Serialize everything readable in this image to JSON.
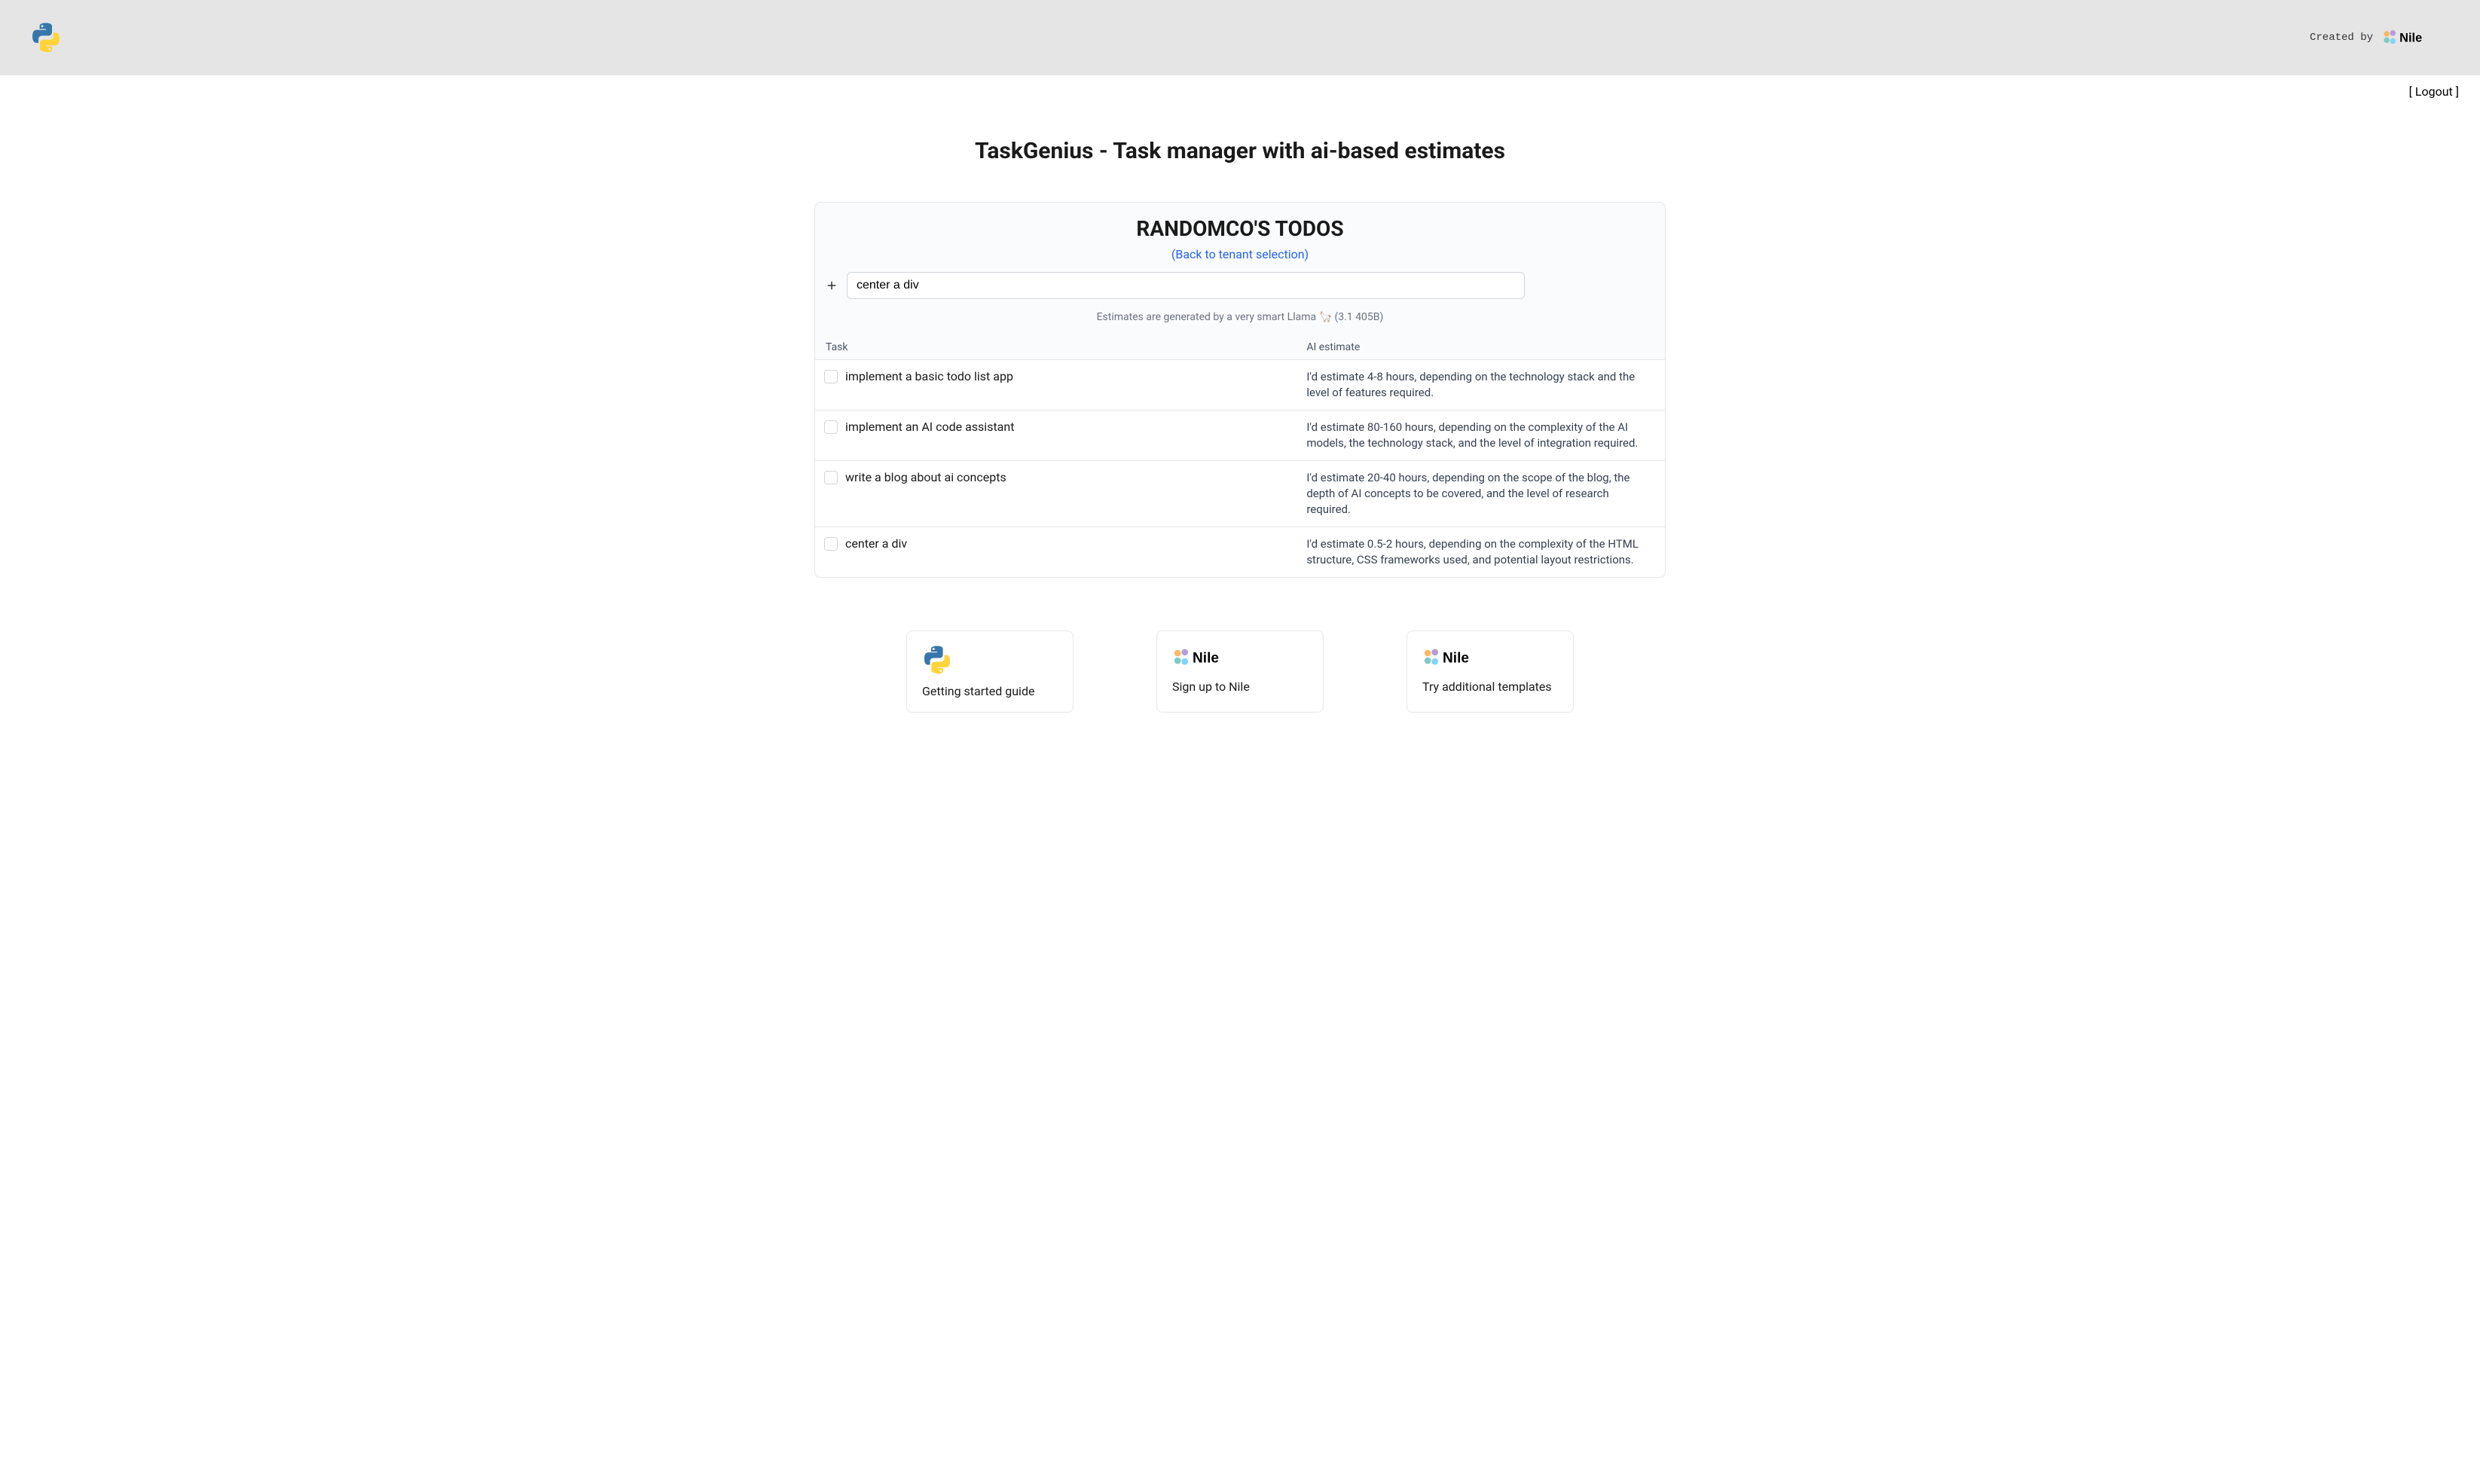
{
  "header": {
    "created_by": "Created by"
  },
  "logout": {
    "label": "[ Logout ]"
  },
  "main_title": "TaskGenius - Task manager with ai-based estimates",
  "todos": {
    "title": "RANDOMCO'S TODOS",
    "back_link": "(Back to tenant selection)",
    "input_value": "center a div",
    "estimate_note": "Estimates are generated by a very smart Llama 🦙 (3.1 405B)",
    "columns": {
      "task": "Task",
      "estimate": "AI estimate"
    },
    "items": [
      {
        "name": "implement a basic todo list app",
        "estimate": "I'd estimate 4-8 hours, depending on the technology stack and the level of features required."
      },
      {
        "name": "implement an AI code assistant",
        "estimate": "I'd estimate 80-160 hours, depending on the complexity of the AI models, the technology stack, and the level of integration required."
      },
      {
        "name": "write a blog about ai concepts",
        "estimate": "I'd estimate 20-40 hours, depending on the scope of the blog, the depth of AI concepts to be covered, and the level of research required."
      },
      {
        "name": "center a div",
        "estimate": "I'd estimate 0.5-2 hours, depending on the complexity of the HTML structure, CSS frameworks used, and potential layout restrictions."
      }
    ]
  },
  "cards": [
    {
      "label": "Getting started guide",
      "icon": "python"
    },
    {
      "label": "Sign up to Nile",
      "icon": "nile"
    },
    {
      "label": "Try additional templates",
      "icon": "nile"
    }
  ]
}
